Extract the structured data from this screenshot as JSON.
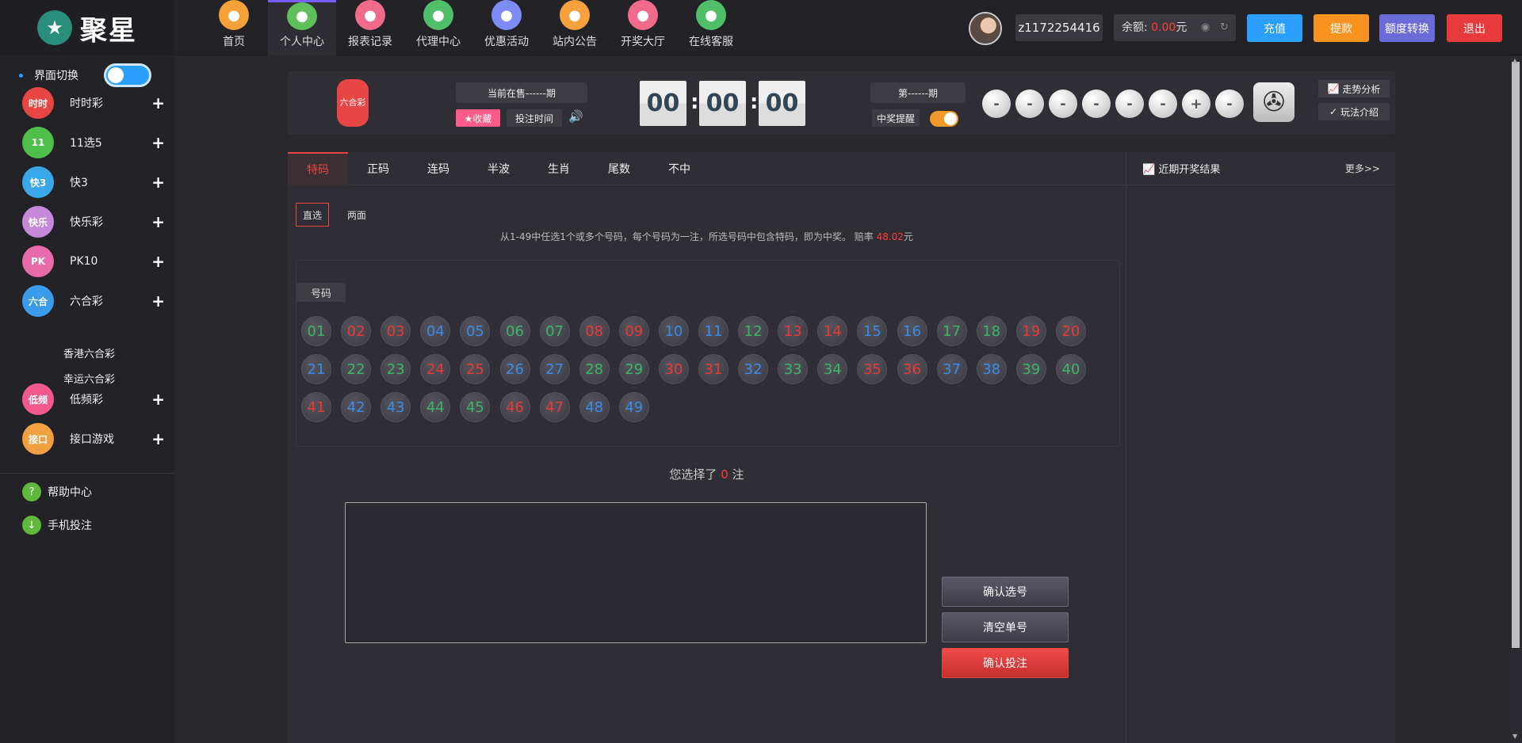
{
  "brand": {
    "name": "聚星"
  },
  "nav": [
    {
      "label": "首页",
      "icon": "home-icon",
      "color": "#f4a13a"
    },
    {
      "label": "个人中心",
      "icon": "crown-icon",
      "color": "#5fbf5a"
    },
    {
      "label": "报表记录",
      "icon": "report-icon",
      "color": "#f06a8c"
    },
    {
      "label": "代理中心",
      "icon": "agent-icon",
      "color": "#4fbf6a"
    },
    {
      "label": "优惠活动",
      "icon": "gift-icon",
      "color": "#7f8bf5"
    },
    {
      "label": "站内公告",
      "icon": "mail-icon",
      "color": "#f7a040"
    },
    {
      "label": "开奖大厅",
      "icon": "grid-icon",
      "color": "#f06a8c"
    },
    {
      "label": "在线客服",
      "icon": "service-icon",
      "color": "#4fbf6a"
    }
  ],
  "user": {
    "username": "z1172254416",
    "balance_label": "余额:",
    "balance_value": "0.00",
    "balance_unit": "元"
  },
  "top_buttons": {
    "recharge": "充值",
    "withdraw": "提款",
    "transfer": "额度转换",
    "logout": "退出"
  },
  "sidebar": {
    "switch_label": "界面切换",
    "items": [
      {
        "label": "时时彩",
        "icon": "ssc-icon",
        "color": "#e84545",
        "abbr": "时时"
      },
      {
        "label": "11选5",
        "icon": "11x5-icon",
        "color": "#4fbf4a",
        "abbr": "11"
      },
      {
        "label": "快3",
        "icon": "k3-icon",
        "color": "#3aa8e8",
        "abbr": "快3"
      },
      {
        "label": "快乐彩",
        "icon": "klc-icon",
        "color": "#c48ad8",
        "abbr": "快乐"
      },
      {
        "label": "PK10",
        "icon": "pk10-icon",
        "color": "#e86aa8",
        "abbr": "PK"
      },
      {
        "label": "六合彩",
        "icon": "lhc-icon",
        "color": "#3a9be8",
        "abbr": "六合"
      },
      {
        "label": "低频彩",
        "icon": "dpc-icon",
        "color": "#f05a8a",
        "abbr": "低频"
      },
      {
        "label": "接口游戏",
        "icon": "api-game-icon",
        "color": "#f0a040",
        "abbr": "接口"
      }
    ],
    "sub_items": [
      "香港六合彩",
      "幸运六合彩"
    ],
    "help": "帮助中心",
    "mobile": "手机投注"
  },
  "draw": {
    "logo_text": "六合彩",
    "current_period": "当前在售------期",
    "favorite": "★收藏",
    "bet_time": "投注时间",
    "countdown": [
      "00",
      "00",
      "00"
    ],
    "issue": "第------期",
    "remind": "中奖提醒",
    "results": [
      "-",
      "-",
      "-",
      "-",
      "-",
      "-",
      "+",
      "-"
    ],
    "trend": "走势分析",
    "rules": "玩法介绍"
  },
  "tabs": [
    "特码",
    "正码",
    "连码",
    "半波",
    "生肖",
    "尾数",
    "不中"
  ],
  "subtabs": [
    "直选",
    "两面"
  ],
  "rule": {
    "text": "从1-49中任选1个或多个号码，每个号码为一注，所选号码中包含特码，即为中奖。 赔率",
    "odds": "48.02",
    "unit": "元"
  },
  "number_title": "号码",
  "numbers": [
    {
      "n": "01",
      "c": "green"
    },
    {
      "n": "02",
      "c": "red"
    },
    {
      "n": "03",
      "c": "red"
    },
    {
      "n": "04",
      "c": "blue"
    },
    {
      "n": "05",
      "c": "blue"
    },
    {
      "n": "06",
      "c": "green"
    },
    {
      "n": "07",
      "c": "green"
    },
    {
      "n": "08",
      "c": "red"
    },
    {
      "n": "09",
      "c": "red"
    },
    {
      "n": "10",
      "c": "blue"
    },
    {
      "n": "11",
      "c": "blue"
    },
    {
      "n": "12",
      "c": "green"
    },
    {
      "n": "13",
      "c": "red"
    },
    {
      "n": "14",
      "c": "red"
    },
    {
      "n": "15",
      "c": "blue"
    },
    {
      "n": "16",
      "c": "blue"
    },
    {
      "n": "17",
      "c": "green"
    },
    {
      "n": "18",
      "c": "green"
    },
    {
      "n": "19",
      "c": "red"
    },
    {
      "n": "20",
      "c": "red"
    },
    {
      "n": "21",
      "c": "blue"
    },
    {
      "n": "22",
      "c": "green"
    },
    {
      "n": "23",
      "c": "green"
    },
    {
      "n": "24",
      "c": "red"
    },
    {
      "n": "25",
      "c": "red"
    },
    {
      "n": "26",
      "c": "blue"
    },
    {
      "n": "27",
      "c": "blue"
    },
    {
      "n": "28",
      "c": "green"
    },
    {
      "n": "29",
      "c": "green"
    },
    {
      "n": "30",
      "c": "red"
    },
    {
      "n": "31",
      "c": "red"
    },
    {
      "n": "32",
      "c": "blue"
    },
    {
      "n": "33",
      "c": "green"
    },
    {
      "n": "34",
      "c": "green"
    },
    {
      "n": "35",
      "c": "red"
    },
    {
      "n": "36",
      "c": "red"
    },
    {
      "n": "37",
      "c": "blue"
    },
    {
      "n": "38",
      "c": "blue"
    },
    {
      "n": "39",
      "c": "green"
    },
    {
      "n": "40",
      "c": "green"
    },
    {
      "n": "41",
      "c": "red"
    },
    {
      "n": "42",
      "c": "blue"
    },
    {
      "n": "43",
      "c": "blue"
    },
    {
      "n": "44",
      "c": "green"
    },
    {
      "n": "45",
      "c": "green"
    },
    {
      "n": "46",
      "c": "red"
    },
    {
      "n": "47",
      "c": "red"
    },
    {
      "n": "48",
      "c": "blue"
    },
    {
      "n": "49",
      "c": "blue"
    }
  ],
  "selection": {
    "prefix": "您选择了",
    "count": "0",
    "suffix": "注"
  },
  "actions": {
    "confirm": "确认选号",
    "clear": "清空单号",
    "submit": "确认投注"
  },
  "recent": {
    "title": "近期开奖结果",
    "more": "更多>>"
  }
}
